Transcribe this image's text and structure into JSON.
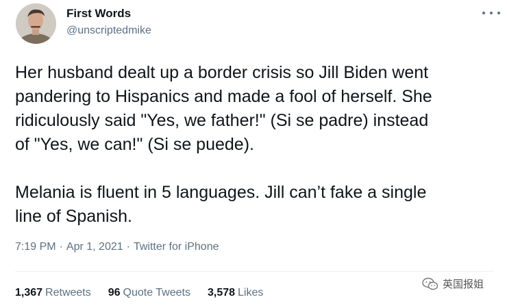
{
  "author": {
    "display_name": "First Words",
    "handle": "@unscriptedmike",
    "avatar_icon": "profile-photo"
  },
  "tweet": {
    "paragraph1_lines": [
      "Her husband dealt up a border crisis so Jill Biden went",
      "pandering to Hispanics and made a fool of herself. She",
      "ridiculously said \"Yes, we father!\" (Si se padre) instead",
      "of \"Yes, we can!\" (Si se puede)."
    ],
    "paragraph2_lines": [
      "Melania is fluent in 5 languages. Jill can’t fake a single",
      "line of Spanish."
    ]
  },
  "meta": {
    "time": "7:19 PM",
    "date": "Apr 1, 2021",
    "source": "Twitter for iPhone",
    "separator": "·"
  },
  "stats": {
    "retweets_count": "1,367",
    "retweets_label": "Retweets",
    "quote_tweets_count": "96",
    "quote_tweets_label": "Quote Tweets",
    "likes_count": "3,578",
    "likes_label": "Likes"
  },
  "watermark": {
    "text": "英国报姐",
    "icon": "wechat-icon"
  },
  "colors": {
    "text_primary": "#0f1419",
    "text_secondary": "#5b7083",
    "divider": "#ebeef0",
    "background": "#ffffff"
  }
}
